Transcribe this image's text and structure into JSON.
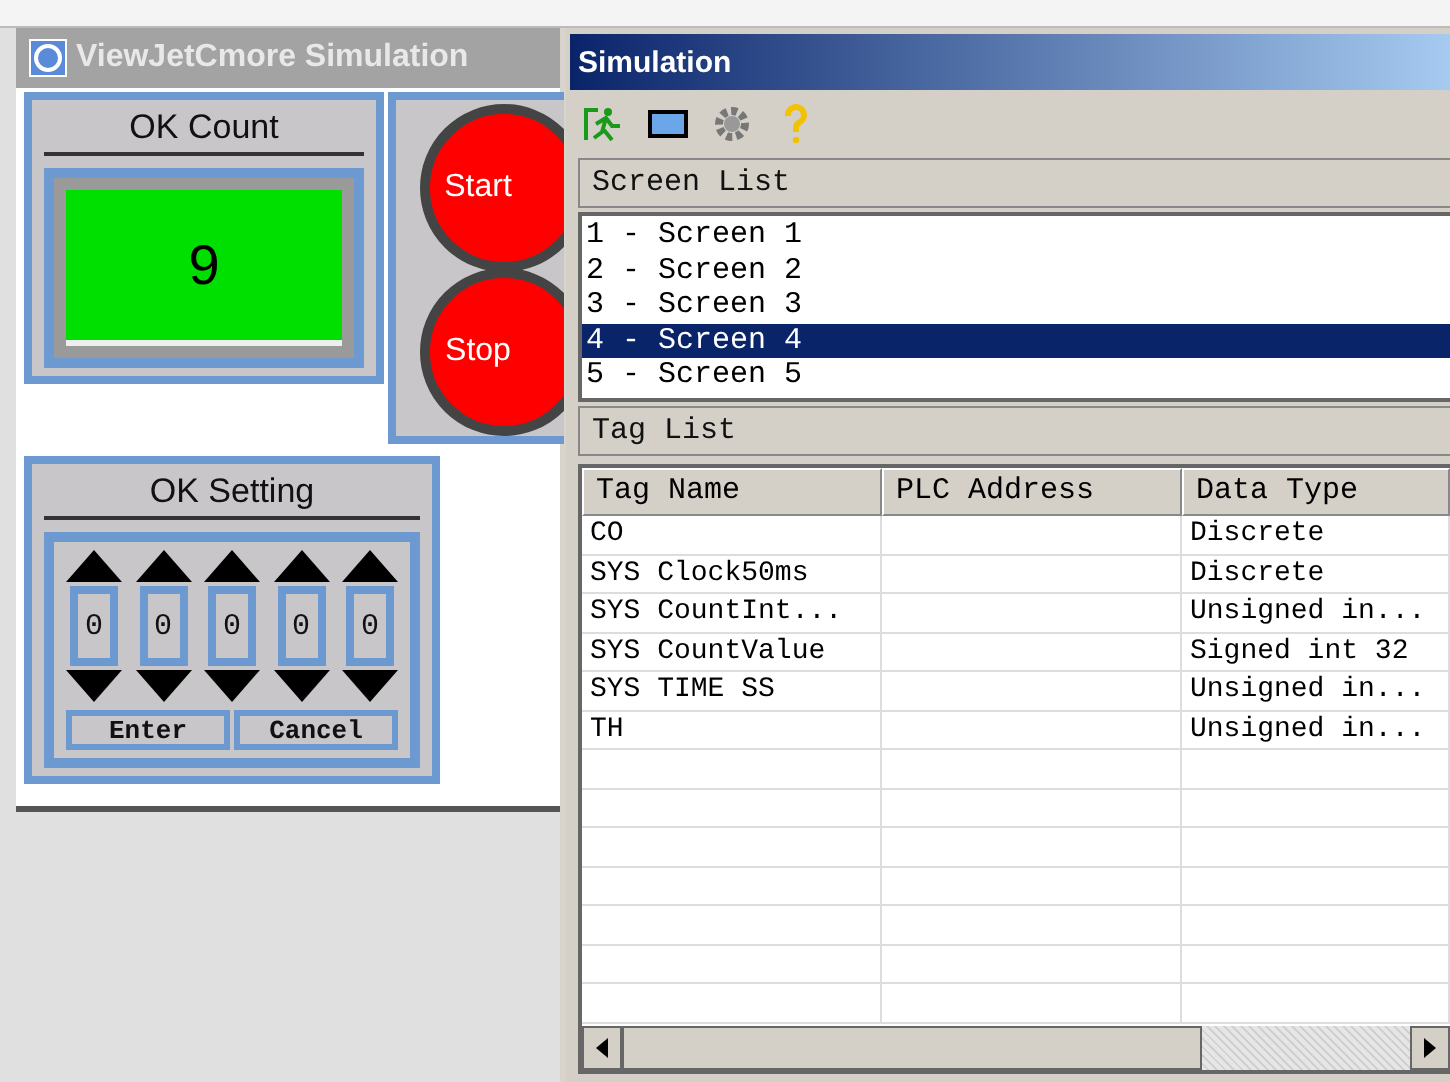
{
  "hmi_window": {
    "title": "ViewJetCmore Simulation",
    "ok_count": {
      "label": "OK Count",
      "value": "9"
    },
    "buttons": [
      {
        "label": "Start"
      },
      {
        "label": "Stop"
      }
    ],
    "ok_setting": {
      "label": "OK Setting",
      "digits": [
        "0",
        "0",
        "0",
        "0",
        "0"
      ],
      "actions": [
        "Enter",
        "Cancel"
      ]
    }
  },
  "sim_window": {
    "title": "Simulation",
    "screen_list": {
      "header": "Screen List",
      "items": [
        {
          "label": "1 - Screen 1",
          "selected": false
        },
        {
          "label": "2 - Screen 2",
          "selected": false
        },
        {
          "label": "3 - Screen 3",
          "selected": false
        },
        {
          "label": "4 - Screen 4",
          "selected": true
        },
        {
          "label": "5 - Screen 5",
          "selected": false
        }
      ]
    },
    "tag_list": {
      "header": "Tag List",
      "columns": [
        "Tag Name",
        "PLC Address",
        "Data Type"
      ],
      "rows": [
        [
          "CO",
          "",
          "Discrete"
        ],
        [
          "SYS Clock50ms",
          "",
          "Discrete"
        ],
        [
          "SYS CountInt...",
          "",
          "Unsigned in..."
        ],
        [
          "SYS CountValue",
          "",
          "Signed int 32"
        ],
        [
          "SYS TIME SS",
          "",
          "Unsigned in..."
        ],
        [
          "TH",
          "",
          "Unsigned in..."
        ]
      ]
    }
  }
}
